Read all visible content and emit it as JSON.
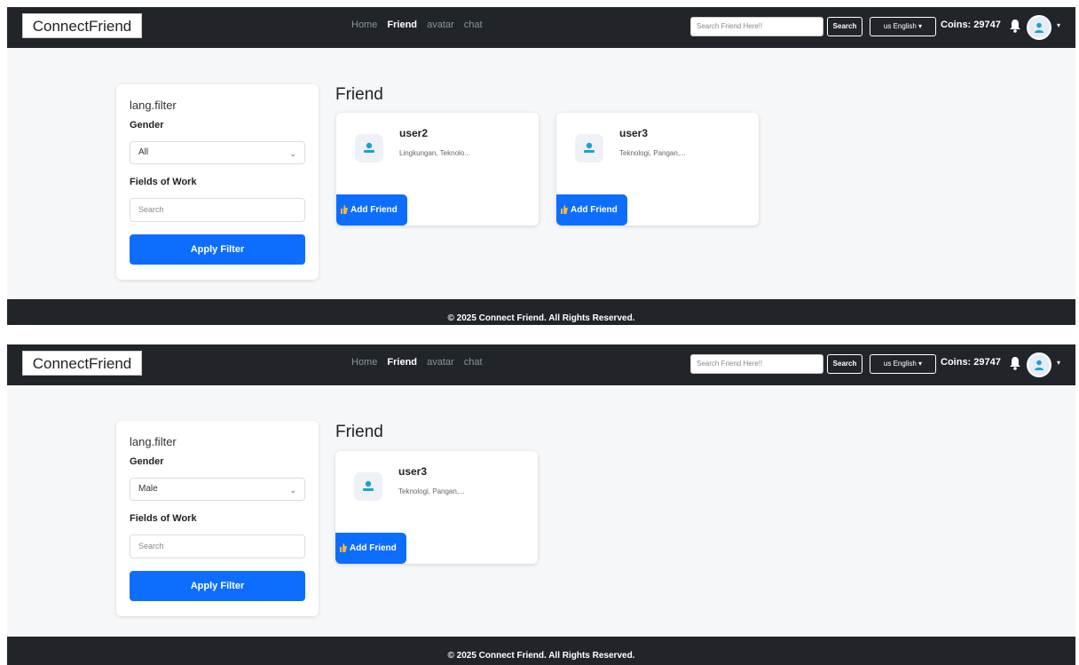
{
  "screens": [
    {
      "nav": {
        "brand": "ConnectFriend",
        "links": [
          "Home",
          "Friend",
          "avatar",
          "chat"
        ],
        "search_placeholder": "Search Friend Here!!",
        "search_button": "Search",
        "language": "us English",
        "coins": "Coins: 29747"
      },
      "filter": {
        "title": "lang.filter",
        "gender_label": "Gender",
        "gender_value": "All",
        "fields_label": "Fields of Work",
        "fields_placeholder": "Search",
        "apply_button": "Apply Filter"
      },
      "section_title": "Friend",
      "friends": [
        {
          "name": "user2",
          "fields": "Lingkungan, Teknolo...",
          "button": "Add Friend"
        },
        {
          "name": "user3",
          "fields": "Teknologi, Pangan,...",
          "button": "Add Friend"
        }
      ],
      "footer": "© 2025 Connect Friend. All Rights Reserved."
    },
    {
      "nav": {
        "brand": "ConnectFriend",
        "links": [
          "Home",
          "Friend",
          "avatar",
          "chat"
        ],
        "search_placeholder": "Search Friend Here!!",
        "search_button": "Search",
        "language": "us English",
        "coins": "Coins: 29747"
      },
      "filter": {
        "title": "lang.filter",
        "gender_label": "Gender",
        "gender_value": "Male",
        "fields_label": "Fields of Work",
        "fields_placeholder": "Search",
        "apply_button": "Apply Filter"
      },
      "section_title": "Friend",
      "friends": [
        {
          "name": "user3",
          "fields": "Teknologi, Pangan,...",
          "button": "Add Friend"
        }
      ],
      "footer": "© 2025 Connect Friend. All Rights Reserved."
    }
  ],
  "colors": {
    "navbar": "#212529",
    "primary": "#0d6efd",
    "page_bg": "#f6f7f9",
    "avatar_icon": "#1aa0d8"
  },
  "icons": {
    "bell": "bell-icon",
    "user": "user-icon",
    "like": "thumbs-up-icon",
    "chevron": "chevron-down-icon"
  }
}
